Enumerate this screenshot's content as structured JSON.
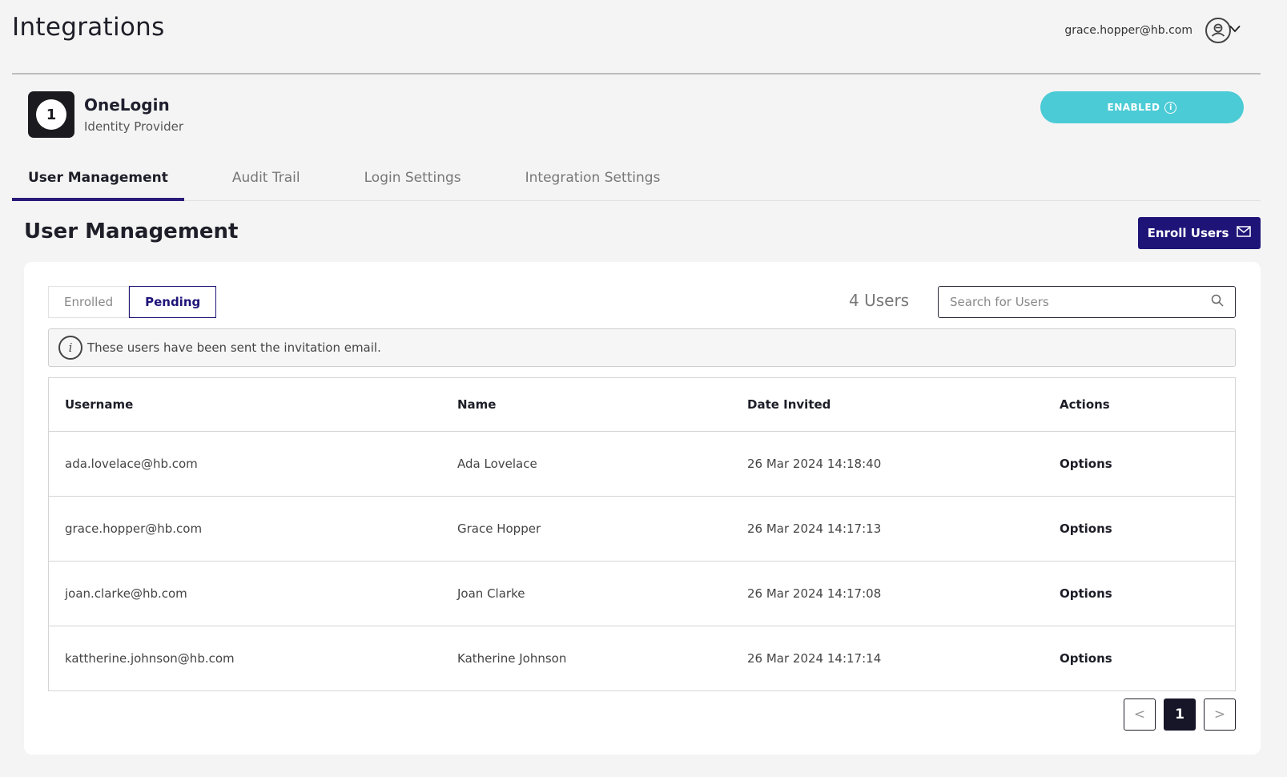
{
  "header": {
    "title": "Integrations",
    "user_email": "grace.hopper@hb.com"
  },
  "provider": {
    "logo_text": "1",
    "name": "OneLogin",
    "type": "Identity Provider",
    "status_label": "ENABLED"
  },
  "tabs": [
    {
      "label": "User Management",
      "active": true
    },
    {
      "label": "Audit Trail",
      "active": false
    },
    {
      "label": "Login Settings",
      "active": false
    },
    {
      "label": "Integration Settings",
      "active": false
    }
  ],
  "section": {
    "title": "User Management",
    "enroll_label": "Enroll Users"
  },
  "filter": {
    "enrolled_label": "Enrolled",
    "pending_label": "Pending",
    "selected": "Pending",
    "user_count": "4 Users",
    "search_placeholder": "Search for Users"
  },
  "notice": "These users have been sent the invitation email.",
  "table": {
    "columns": [
      "Username",
      "Name",
      "Date Invited",
      "Actions"
    ],
    "rows": [
      {
        "username": "ada.lovelace@hb.com",
        "name": "Ada Lovelace",
        "date": "26 Mar 2024 14:18:40",
        "action": "Options"
      },
      {
        "username": "grace.hopper@hb.com",
        "name": "Grace Hopper",
        "date": "26 Mar 2024 14:17:13",
        "action": "Options"
      },
      {
        "username": "joan.clarke@hb.com",
        "name": "Joan Clarke",
        "date": "26 Mar 2024 14:17:08",
        "action": "Options"
      },
      {
        "username": "kattherine.johnson@hb.com",
        "name": "Katherine Johnson",
        "date": "26 Mar 2024 14:17:14",
        "action": "Options"
      }
    ]
  },
  "pagination": {
    "current_page": "1",
    "prev_glyph": "<",
    "next_glyph": ">"
  },
  "colors": {
    "accent": "#1e1478",
    "enabled": "#4bcbd6"
  },
  "icons": [
    "user-avatar-icon",
    "chevron-down-icon",
    "info-icon",
    "mail-icon",
    "search-icon"
  ]
}
